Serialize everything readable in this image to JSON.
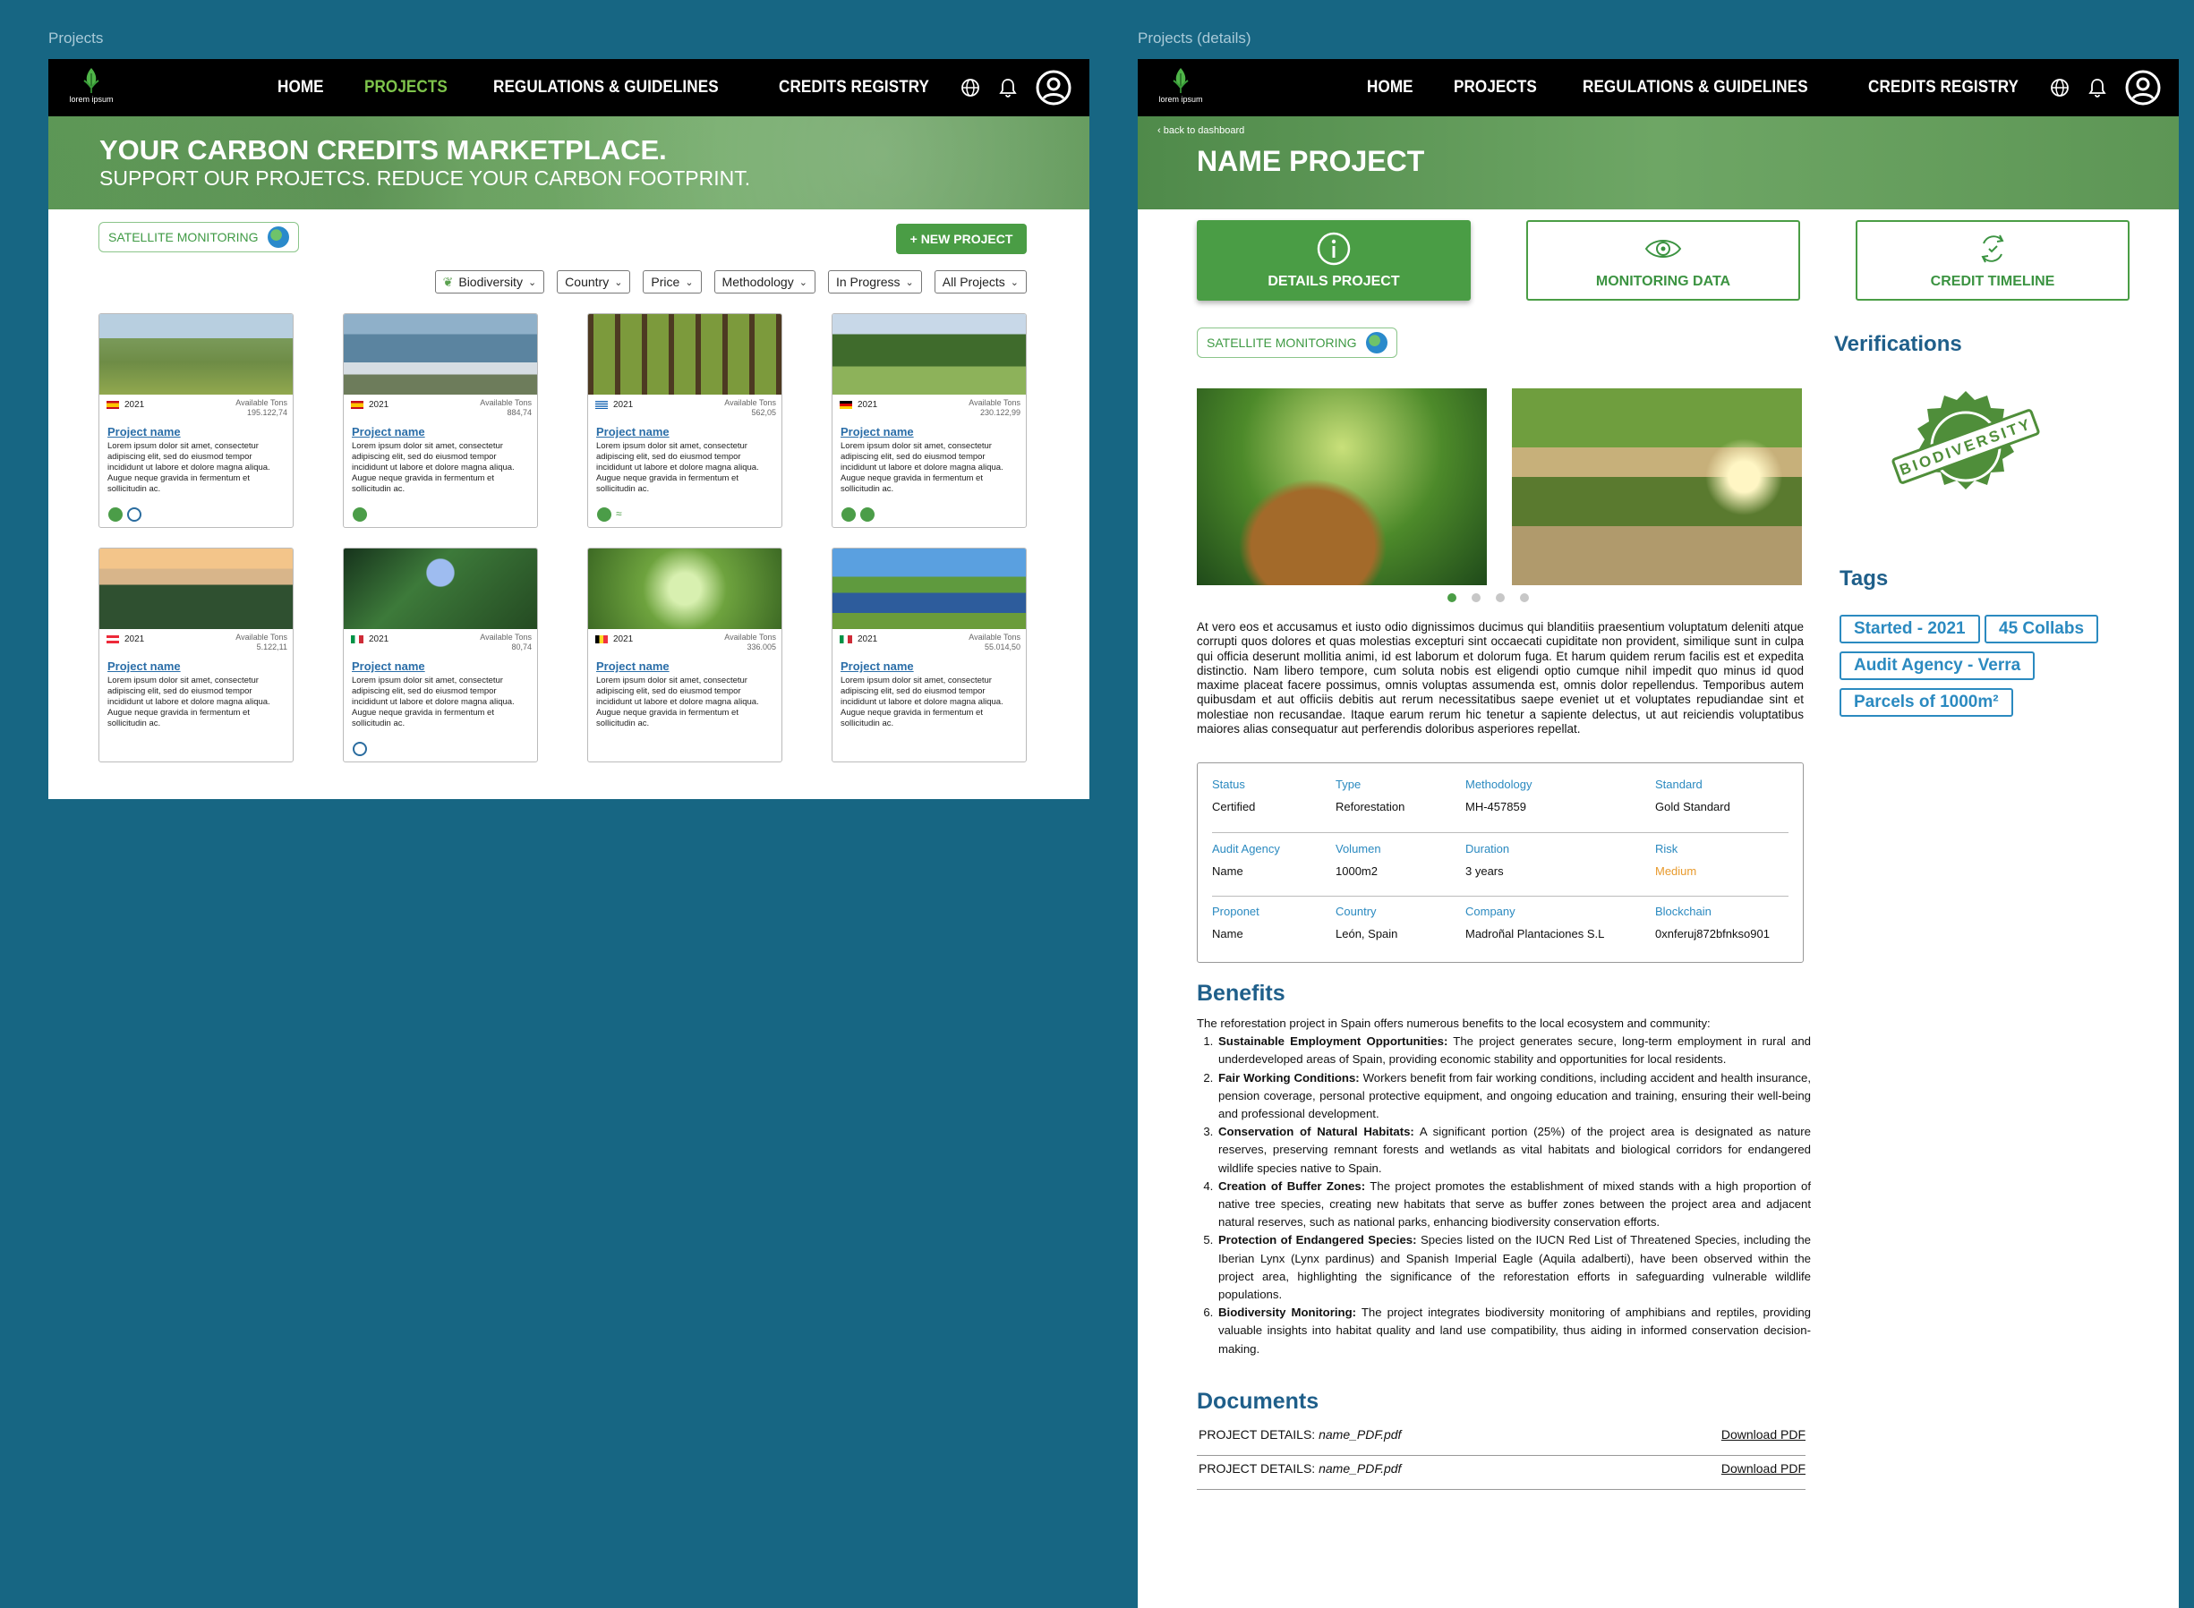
{
  "labels": {
    "frame1": "Projects",
    "frame2": "Projects (details)"
  },
  "logo": {
    "text": "lorem ipsum"
  },
  "nav": {
    "home": "HOME",
    "projects": "PROJECTS",
    "regulations": "REGULATIONS & GUIDELINES",
    "registry": "CREDITS REGISTRY"
  },
  "marketplace": {
    "hero_title": "YOUR CARBON CREDITS MARKETPLACE.",
    "hero_subtitle": "SUPPORT OUR PROJETCS. REDUCE YOUR CARBON FOOTPRINT.",
    "satellite": "SATELLITE MONITORING",
    "new_project": "+ NEW PROJECT",
    "filters": [
      "Biodiversity",
      "Country",
      "Price",
      "Methodology",
      "In Progress",
      "All Projects"
    ],
    "cards": [
      {
        "year": "2021",
        "tons_label": "Available Tons",
        "tons": "195.122,74",
        "name": "Project name",
        "desc": "Lorem ipsum dolor sit amet, consectetur adipiscing elit, sed do eiusmod tempor incididunt ut labore et dolore magna aliqua. Augue neque gravida in fermentum et sollicitudin ac."
      },
      {
        "year": "2021",
        "tons_label": "Available Tons",
        "tons": "884,74",
        "name": "Project name",
        "desc": "Lorem ipsum dolor sit amet, consectetur adipiscing elit, sed do eiusmod tempor incididunt ut labore et dolore magna aliqua. Augue neque gravida in fermentum et sollicitudin ac."
      },
      {
        "year": "2021",
        "tons_label": "Available Tons",
        "tons": "562,05",
        "name": "Project name",
        "desc": "Lorem ipsum dolor sit amet, consectetur adipiscing elit, sed do eiusmod tempor incididunt ut labore et dolore magna aliqua. Augue neque gravida in fermentum et sollicitudin ac."
      },
      {
        "year": "2021",
        "tons_label": "Available Tons",
        "tons": "230.122,99",
        "name": "Project name",
        "desc": "Lorem ipsum dolor sit amet, consectetur adipiscing elit, sed do eiusmod tempor incididunt ut labore et dolore magna aliqua. Augue neque gravida in fermentum et sollicitudin ac."
      },
      {
        "year": "2021",
        "tons_label": "Available Tons",
        "tons": "5.122,11",
        "name": "Project name",
        "desc": "Lorem ipsum dolor sit amet, consectetur adipiscing elit, sed do eiusmod tempor incididunt ut labore et dolore magna aliqua. Augue neque gravida in fermentum et sollicitudin ac."
      },
      {
        "year": "2021",
        "tons_label": "Available Tons",
        "tons": "80,74",
        "name": "Project name",
        "desc": "Lorem ipsum dolor sit amet, consectetur adipiscing elit, sed do eiusmod tempor incididunt ut labore et dolore magna aliqua. Augue neque gravida in fermentum et sollicitudin ac."
      },
      {
        "year": "2021",
        "tons_label": "Available Tons",
        "tons": "336.005",
        "name": "Project name",
        "desc": "Lorem ipsum dolor sit amet, consectetur adipiscing elit, sed do eiusmod tempor incididunt ut labore et dolore magna aliqua. Augue neque gravida in fermentum et sollicitudin ac."
      },
      {
        "year": "2021",
        "tons_label": "Available Tons",
        "tons": "55.014,50",
        "name": "Project name",
        "desc": "Lorem ipsum dolor sit amet, consectetur adipiscing elit, sed do eiusmod tempor incididunt ut labore et dolore magna aliqua. Augue neque gravida in fermentum et sollicitudin ac."
      }
    ]
  },
  "detail": {
    "back": "back to dashboard",
    "title": "NAME PROJECT",
    "tabs": [
      "DETAILS PROJECT",
      "MONITORING DATA",
      "CREDIT TIMELINE"
    ],
    "satellite": "SATELLITE MONITORING",
    "description": "At vero eos et accusamus et iusto odio dignissimos ducimus qui blanditiis praesentium voluptatum deleniti atque corrupti quos dolores et quas molestias excepturi sint occaecati cupiditate non provident, similique sunt in culpa qui officia deserunt mollitia animi, id est laborum et dolorum fuga. Et harum quidem rerum facilis est et expedita distinctio. Nam libero tempore, cum soluta nobis est eligendi optio cumque nihil impedit quo minus id quod maxime placeat facere possimus, omnis voluptas assumenda est, omnis dolor repellendus. Temporibus autem quibusdam et aut officiis debitis aut rerum necessitatibus saepe eveniet ut et voluptates repudiandae sint et molestiae non recusandae. Itaque earum rerum hic tenetur a sapiente delectus, ut aut reiciendis voluptatibus maiores alias consequatur aut perferendis doloribus asperiores repellat.",
    "info": [
      [
        {
          "k": "Status",
          "v": "Certified"
        },
        {
          "k": "Type",
          "v": "Reforestation"
        },
        {
          "k": "Methodology",
          "v": "MH-457859"
        },
        {
          "k": "Standard",
          "v": "Gold Standard"
        }
      ],
      [
        {
          "k": "Audit Agency",
          "v": "Name"
        },
        {
          "k": "Volumen",
          "v": "1000m2"
        },
        {
          "k": "Duration",
          "v": "3 years"
        },
        {
          "k": "Risk",
          "v": "Medium"
        }
      ],
      [
        {
          "k": "Proponet",
          "v": "Name"
        },
        {
          "k": "Country",
          "v": "León, Spain"
        },
        {
          "k": "Company",
          "v": "Madroñal Plantaciones S.L"
        },
        {
          "k": "Blockchain",
          "v": "0xnferuj872bfnkso901"
        }
      ]
    ],
    "risk_color": "#e89a2c",
    "benefits_title": "Benefits",
    "benefits_intro": "The reforestation project in Spain offers numerous benefits to the local ecosystem and community:",
    "benefits": [
      {
        "t": "Sustainable Employment Opportunities:",
        "d": " The project generates secure, long-term employment in rural and underdeveloped areas of Spain, providing economic stability and opportunities for local residents."
      },
      {
        "t": "Fair Working Conditions:",
        "d": " Workers benefit from fair working conditions, including accident and health insurance, pension coverage, personal protective equipment, and ongoing education and training, ensuring their well-being and professional development."
      },
      {
        "t": "Conservation of Natural Habitats:",
        "d": " A significant portion (25%) of the project area is designated as nature reserves, preserving remnant forests and wetlands as vital habitats and biological corridors for endangered wildlife species native to Spain."
      },
      {
        "t": "Creation of Buffer Zones:",
        "d": " The project promotes the establishment of mixed stands with a high proportion of native tree species, creating new habitats that serve as buffer zones between the project area and adjacent natural reserves, such as national parks, enhancing biodiversity conservation efforts."
      },
      {
        "t": "Protection of Endangered Species:",
        "d": " Species listed on the IUCN Red List of Threatened Species, including the Iberian Lynx (Lynx pardinus) and Spanish Imperial Eagle (Aquila adalberti), have been observed within the project area, highlighting the significance of the reforestation efforts in safeguarding vulnerable wildlife populations."
      },
      {
        "t": "Biodiversity Monitoring:",
        "d": " The project integrates biodiversity monitoring of amphibians and reptiles, providing valuable insights into habitat quality and land use compatibility, thus aiding in informed conservation decision-making."
      }
    ],
    "documents_title": "Documents",
    "documents": [
      {
        "label": "PROJECT DETAILS: ",
        "file": "name_PDF.pdf",
        "link": "Download PDF"
      },
      {
        "label": "PROJECT DETAILS: ",
        "file": "name_PDF.pdf",
        "link": "Download PDF"
      }
    ],
    "verifications_title": "Verifications",
    "seal_text": "BIODIVERSITY",
    "tags_title": "Tags",
    "tags": [
      "Started - 2021",
      "45 Collabs",
      "Audit Agency - Verra",
      "Parcels of 1000m²"
    ]
  },
  "colors": {
    "accent": "#4a9d45",
    "blue": "#1f5f8a",
    "background": "#176683"
  }
}
